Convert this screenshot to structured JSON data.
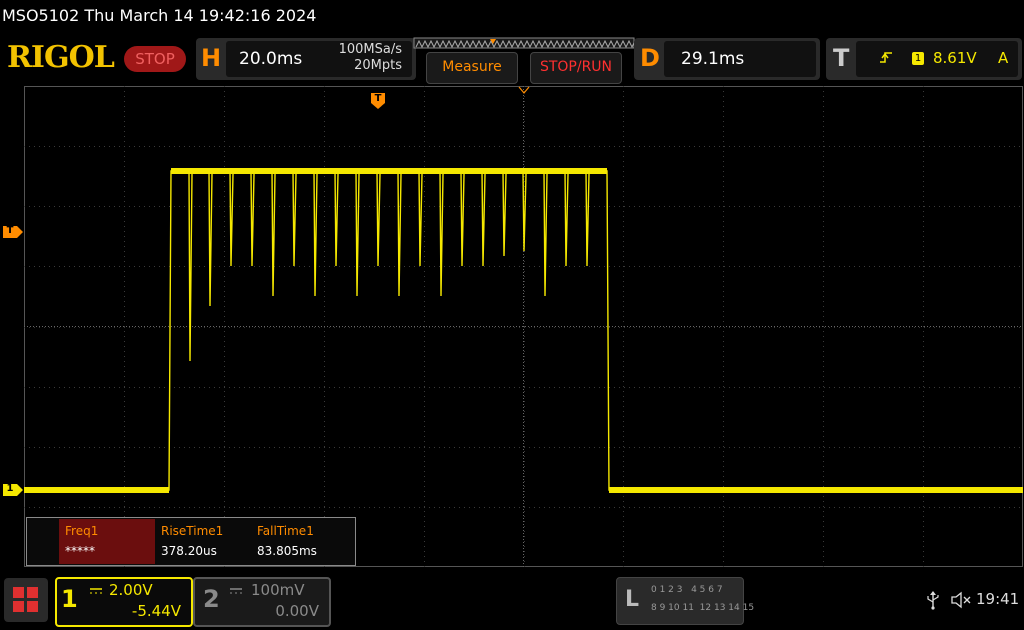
{
  "title": "MSO5102  Thu March 14 19:42:16 2024",
  "brand": "RIGOL",
  "run_status": "STOP",
  "horizontal": {
    "letter": "H",
    "timebase": "20.0ms",
    "sample_rate": "100MSa/s",
    "memory_depth": "20Mpts"
  },
  "buttons": {
    "measure": "Measure",
    "stop_run": "STOP/RUN"
  },
  "delay": {
    "letter": "D",
    "value": "29.1ms"
  },
  "trigger": {
    "letter": "T",
    "source": "1",
    "level": "8.61V",
    "coupling": "A"
  },
  "markers": {
    "trigger_pos": "T",
    "trigger_level": "T",
    "ch1_ground": "1"
  },
  "measurements": [
    {
      "label": "Freq1",
      "value": "*****"
    },
    {
      "label": "RiseTime1",
      "value": "378.20us"
    },
    {
      "label": "FallTime1",
      "value": "83.805ms"
    }
  ],
  "channels": [
    {
      "num": "1",
      "scale": "2.00V",
      "offset": "-5.44V",
      "color": "#f5e800",
      "active": true
    },
    {
      "num": "2",
      "scale": "100mV",
      "offset": "0.00V",
      "color": "#8a8a8a",
      "active": false
    }
  ],
  "logic": {
    "letter": "L",
    "row1": "0 1 2 3   4 5 6 7",
    "row2": "8 9 10 11  12 13 14 15"
  },
  "status": {
    "time": "19:41"
  },
  "colors": {
    "trace": "#f5e800",
    "accent": "#ff8c00",
    "grid": "#3a3a3a",
    "stop": "#a01818"
  }
}
